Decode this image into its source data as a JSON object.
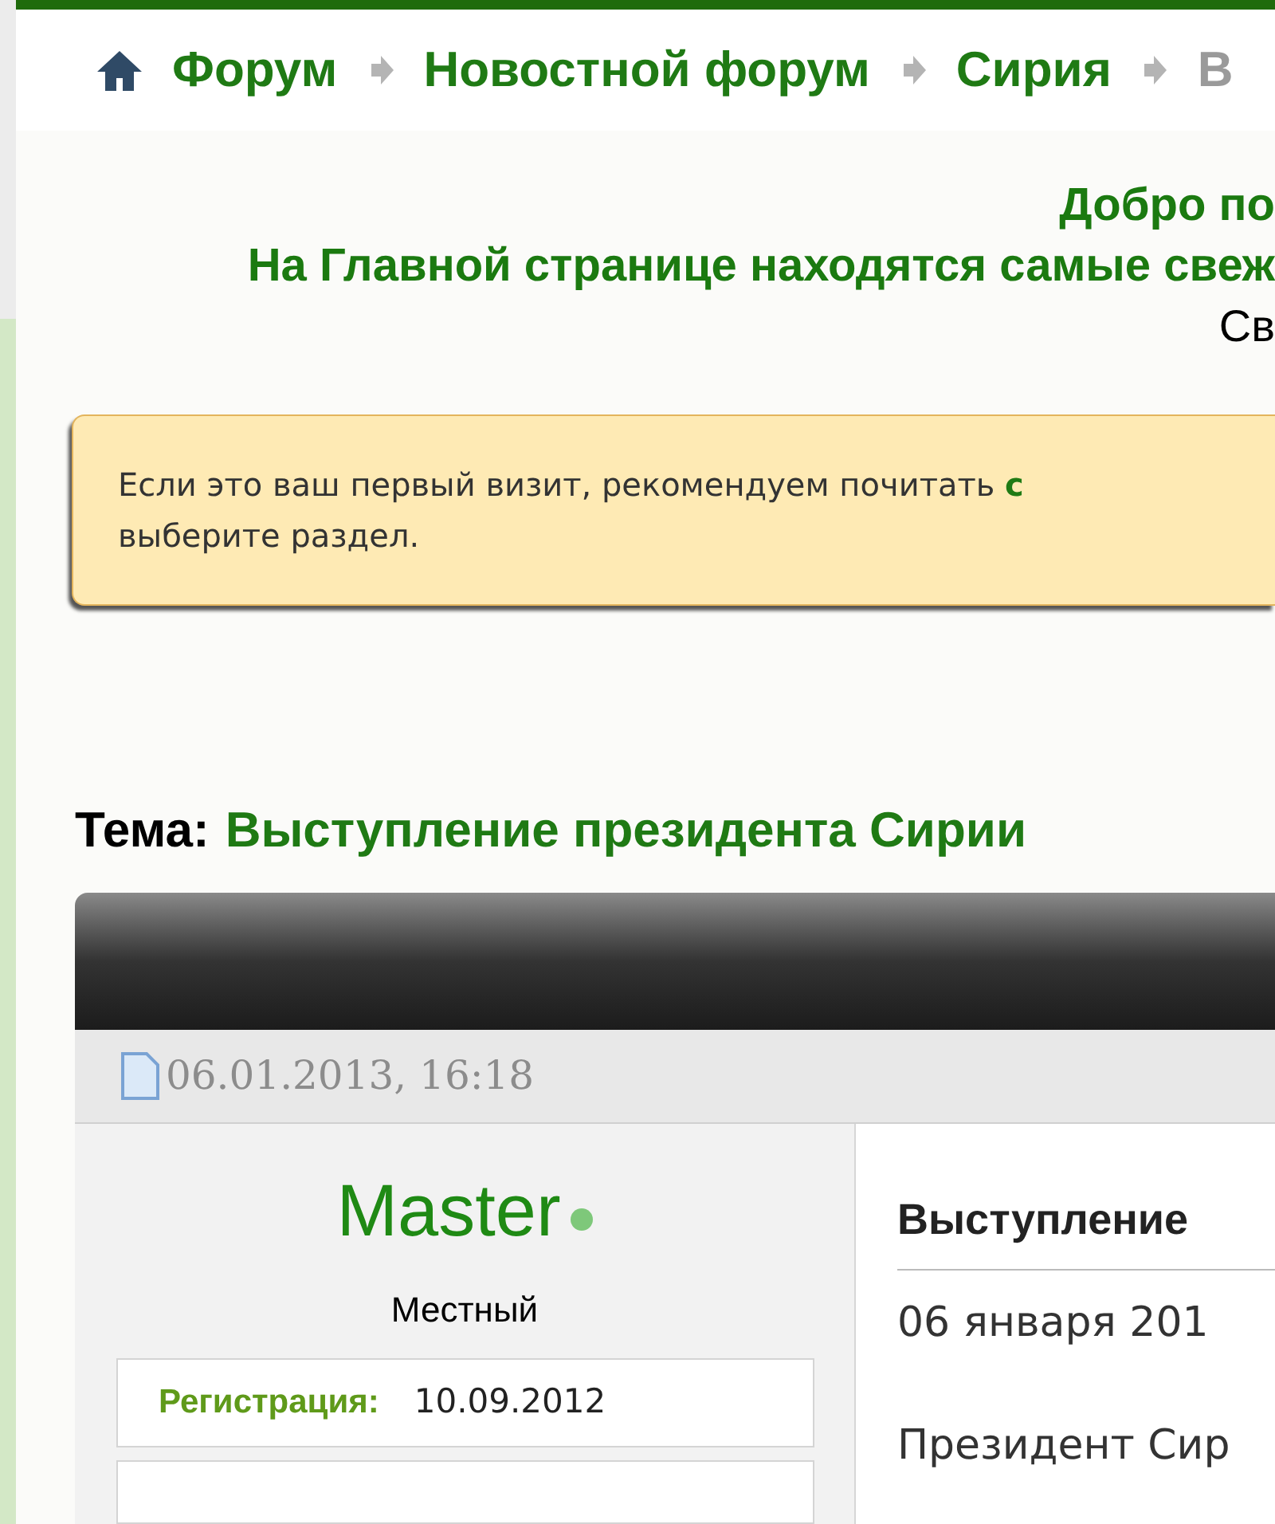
{
  "breadcrumb": [
    {
      "label": "Форум",
      "current": false
    },
    {
      "label": "Новостной форум",
      "current": false
    },
    {
      "label": "Сирия",
      "current": false
    },
    {
      "label": "В",
      "current": true
    }
  ],
  "welcome": {
    "lines": [
      "Добро по",
      "На Главной странице находятся самые свеж"
    ],
    "note": "Св"
  },
  "notice": {
    "text": "Если это ваш первый визит, рекомендуем почитать",
    "link": "с",
    "text_after": "выберите раздел."
  },
  "topic": {
    "label": "Тема:",
    "title": "Выступление президента Сирии"
  },
  "post": {
    "date": "06.01.2013, 16:18",
    "author": {
      "name": "Master",
      "online": true,
      "rank": "Местный",
      "fields": [
        {
          "label": "Регистрация:",
          "value": "10.09.2012"
        }
      ]
    },
    "title": "Выступление",
    "date_line": "06 января 201",
    "body": "Президент Сир"
  }
}
